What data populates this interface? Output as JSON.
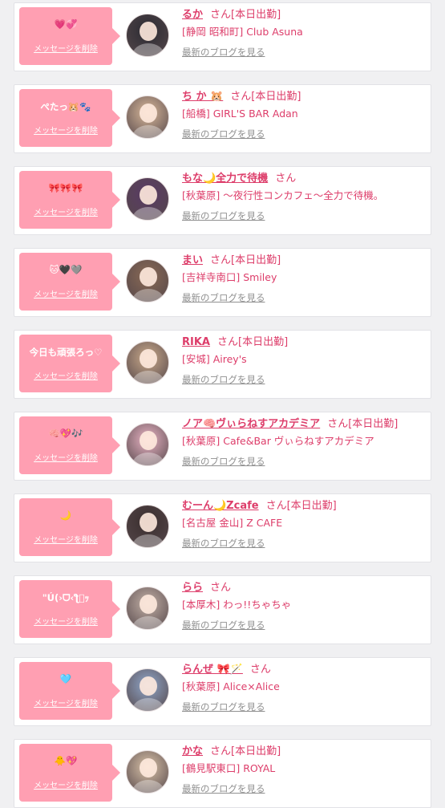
{
  "items": [
    {
      "bubble": "💗💞",
      "delete_label": "メッセージを削除",
      "name": "るか",
      "honorific": "さん",
      "status": "[本日出勤]",
      "shop": "[静岡 昭和町] Club Asuna",
      "blog_link": "最新のブログを見る",
      "avatar_color": "#2b2b33"
    },
    {
      "bubble": "ぺたっ🐹🐾",
      "delete_label": "メッセージを削除",
      "name": "ち か 🐹",
      "honorific": "さん",
      "status": "[本日出勤]",
      "shop": "[船橋] GIRL'S BAR Adan",
      "blog_link": "最新のブログを見る",
      "avatar_color": "#d8b89a"
    },
    {
      "bubble": "🎀🎀🎀",
      "delete_label": "メッセージを削除",
      "name": "もな🌙全力で待機",
      "honorific": "さん",
      "status": "",
      "shop": "[秋葉原] 〜夜行性コンカフェ〜全力で待機。",
      "blog_link": "最新のブログを見る",
      "avatar_color": "#5a3a66"
    },
    {
      "bubble": "🐱🖤🩶",
      "delete_label": "メッセージを削除",
      "name": "まい",
      "honorific": "さん",
      "status": "[本日出勤]",
      "shop": "[吉祥寺南口] Smiley",
      "blog_link": "最新のブログを見る",
      "avatar_color": "#8a6a55"
    },
    {
      "bubble": "今日も頑張ろっ♡",
      "delete_label": "メッセージを削除",
      "name": "RIKA",
      "honorific": "さん",
      "status": "[本日出勤]",
      "shop": "[安城] Airey's",
      "blog_link": "最新のブログを見る",
      "avatar_color": "#c9a98a"
    },
    {
      "bubble": "🧠💖🎶",
      "delete_label": "メッセージを削除",
      "name": "ノア🧠ヴぃらねすアカデミア",
      "honorific": "さん",
      "status": "[本日出勤]",
      "shop": "[秋葉原] Cafe&Bar ヴぃらねすアカデミア",
      "blog_link": "最新のブログを見る",
      "avatar_color": "#e9b3c4"
    },
    {
      "bubble": "🌙",
      "delete_label": "メッセージを削除",
      "name": "むーん🌙Zcafe",
      "honorific": "さん",
      "status": "[本日出勤]",
      "shop": "[名古屋 金山] Z CAFE",
      "blog_link": "最新のブログを見る",
      "avatar_color": "#3a2e2e"
    },
    {
      "bubble": "\"Ú(›ᗜ‹ƪ゙ｯ",
      "delete_label": "メッセージを削除",
      "name": "らら",
      "honorific": "さん",
      "status": "",
      "shop": "[本厚木] わっ!!ちゃちゃ",
      "blog_link": "最新のブログを見る",
      "avatar_color": "#c2b0a6"
    },
    {
      "bubble": "🩵",
      "delete_label": "メッセージを削除",
      "name": "らんぜ 🎀🪄",
      "honorific": "さん",
      "status": "",
      "shop": "[秋葉原] Alice×Alice",
      "blog_link": "最新のブログを見る",
      "avatar_color": "#8fa6c9"
    },
    {
      "bubble": "🐥💖",
      "delete_label": "メッセージを削除",
      "name": "かな",
      "honorific": "さん",
      "status": "[本日出勤]",
      "shop": "[鶴見駅東口] ROYAL",
      "blog_link": "最新のブログを見る",
      "avatar_color": "#d9c2a8"
    }
  ],
  "colors": {
    "bubble": "#ff9fb2",
    "accent": "#dd3d6a",
    "link": "#909090"
  }
}
